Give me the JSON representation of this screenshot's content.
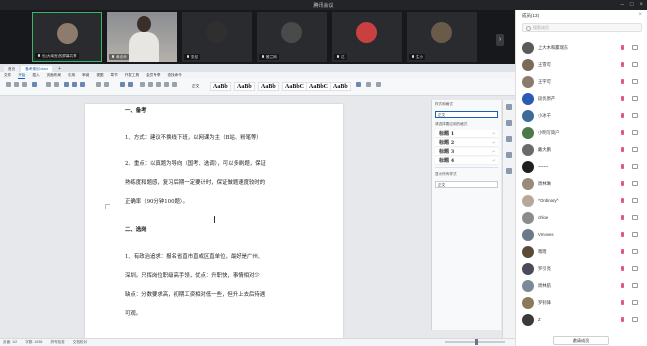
{
  "window": {
    "title": "腾讯会议"
  },
  "tiles": [
    {
      "name": "也(大南宫)的屏幕共享",
      "kind": "screen",
      "color": "#8d7c6e"
    },
    {
      "name": "黄老师",
      "kind": "video",
      "color": "#6c6f73"
    },
    {
      "name": "张尼",
      "kind": "avatar",
      "color": "#2f2f2f"
    },
    {
      "name": "殷兰网",
      "kind": "avatar",
      "color": "#4a4a4a"
    },
    {
      "name": "达",
      "kind": "avatar",
      "color": "#c94040"
    },
    {
      "name": "生小",
      "kind": "avatar",
      "color": "#6a5a4a"
    }
  ],
  "wps": {
    "tabs": [
      "首页",
      "备考规划.docx"
    ],
    "menus": [
      "文件",
      "开始",
      "插入",
      "页面布局",
      "引用",
      "审阅",
      "视图",
      "章节",
      "开发工具",
      "会员专享",
      "查找命令"
    ],
    "styles": [
      "AaBb",
      "AaBb",
      "AaBb",
      "AaBbC",
      "AaBbC",
      "AaBb"
    ],
    "style_caption": "正文",
    "doc": {
      "lines": [
        {
          "text": "一、备考",
          "bold": true
        },
        {
          "text": "1、方式：建议不换线下班，以网课为主（B站、粉笔等）",
          "bold": false
        },
        {
          "text": "2、重点：以真题为导向（国考、选调），可以多刷题，保证",
          "bold": false
        },
        {
          "text": "熟练度和题感，复习后期一定要计时，保证做题速度较时的",
          "bold": false
        },
        {
          "text": "正确率（90分钟100题）。",
          "bold": false
        },
        {
          "text": "二、选岗",
          "bold": true
        },
        {
          "text": "1、有政治追求：报名省直市直或区直单位，最好是广州、",
          "bold": false
        },
        {
          "text": "深圳。只挥岗位职级高手领，优点：升职快，事情相对少",
          "bold": false
        },
        {
          "text": "缺点：分数要求高，初期工资相对低一些，但升上去后待遇",
          "bold": false
        },
        {
          "text": "可观。",
          "bold": false
        }
      ]
    },
    "nav": {
      "title": "样式和格式",
      "current_label": "正文",
      "clear_label": "请选择要应用的格式",
      "items": [
        "标题 1",
        "标题 2",
        "标题 3",
        "标题 4"
      ],
      "show_label": "显示所有样式",
      "bottom_label": "正文"
    },
    "status": [
      "页面: 1/2",
      "字数: 1538",
      "拼写检查",
      "文档校对"
    ]
  },
  "members": {
    "title": "成员(13)",
    "search_placeholder": "搜索成员",
    "invite_label": "邀请成员",
    "list": [
      {
        "name": "上大木和赢瑞东",
        "color": "#5a5a5a"
      },
      {
        "name": "王雪可",
        "color": "#7a6a5a"
      },
      {
        "name": "王宇可",
        "color": "#8a7a6a"
      },
      {
        "name": "段优原产",
        "color": "#2a5ab4"
      },
      {
        "name": "小冰千",
        "color": "#3d6b9a"
      },
      {
        "name": "小明写简户",
        "color": "#4a7a4a"
      },
      {
        "name": "戴大鹏",
        "color": "#6a6a6a"
      },
      {
        "name": "~~~~",
        "color": "#1f1f1f"
      },
      {
        "name": "周林琳",
        "color": "#9a8a7a"
      },
      {
        "name": "^Ordinary^",
        "color": "#b7a89a"
      },
      {
        "name": "chloe",
        "color": "#8c8c8c"
      },
      {
        "name": "Vmoves",
        "color": "#6a7a8a"
      },
      {
        "name": "嗯嗯",
        "color": "#5a4a3a"
      },
      {
        "name": "罗引亮",
        "color": "#4a4a5a"
      },
      {
        "name": "周林航",
        "color": "#7a8a9a"
      },
      {
        "name": "罗钊锋",
        "color": "#8a7a5a"
      },
      {
        "name": "Z",
        "color": "#3a3a3a"
      }
    ]
  }
}
